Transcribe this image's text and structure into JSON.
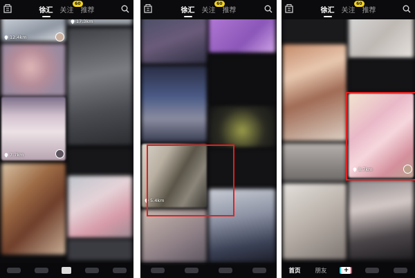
{
  "panels": [
    {
      "nav": {
        "tabs": [
          {
            "label": "徐汇",
            "active": true
          },
          {
            "label": "关注",
            "active": false
          },
          {
            "label": "推荐",
            "active": false
          }
        ],
        "badge": "60"
      },
      "tile_distances": [
        "12.4km",
        "17.3km",
        "7.7km"
      ]
    },
    {
      "nav": {
        "tabs": [
          {
            "label": "徐汇",
            "active": true
          },
          {
            "label": "关注",
            "active": false
          },
          {
            "label": "推荐",
            "active": false
          }
        ],
        "badge": "60"
      },
      "tile_distances": [
        "5.4km"
      ]
    },
    {
      "nav": {
        "tabs": [
          {
            "label": "徐汇",
            "active": true
          },
          {
            "label": "关注",
            "active": false
          },
          {
            "label": "推荐",
            "active": false
          }
        ],
        "badge": "60"
      },
      "tile_distances": [
        "8.7km"
      ],
      "bottom_nav": {
        "home": "首页",
        "friends": "朋友",
        "plus": "+"
      }
    }
  ],
  "colors": {
    "highlight": "#e02020",
    "badge": "#f3d21f",
    "background": "#0b0b0d"
  },
  "icons": [
    "city-icon",
    "search-icon",
    "location-pin-icon",
    "plus-icon"
  ]
}
